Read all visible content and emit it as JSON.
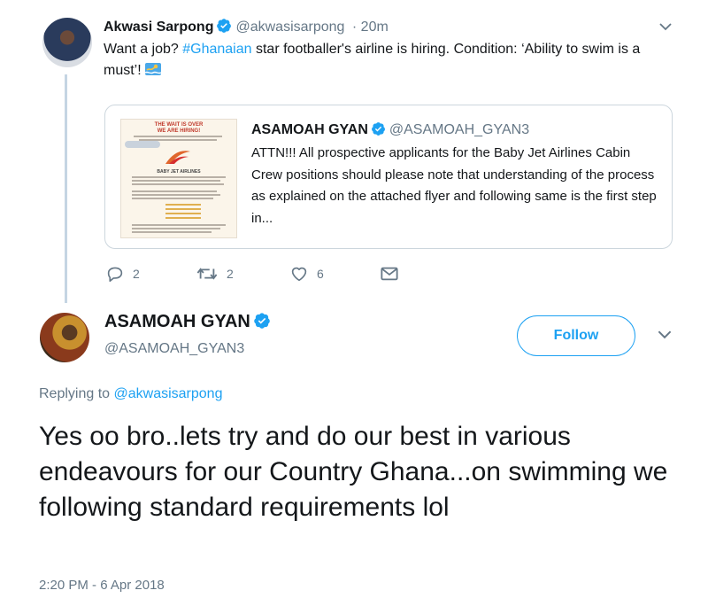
{
  "tweet1": {
    "author_name": "Akwasi Sarpong",
    "handle": "@akwasisarpong",
    "time": "· 20m",
    "text_before": "Want a job? ",
    "hashtag": "#Ghanaian",
    "text_after": " star footballer's airline is hiring. Condition: ‘Ability to swim is a must’! ",
    "emoji": "swimmer-emoji",
    "quoted": {
      "author_name": "ASAMOAH GYAN",
      "handle": "@ASAMOAH_GYAN3",
      "text": "ATTN!!! All prospective applicants for the Baby Jet Airlines Cabin Crew positions should please note that understanding of the process as explained on the attached flyer and following same is the first step in...",
      "flyer": {
        "title": "THE WAIT IS OVER\nWE ARE HIRING!",
        "brand": "BABY JET AIRLINES"
      }
    },
    "actions": {
      "reply_count": "2",
      "retweet_count": "2",
      "like_count": "6"
    }
  },
  "tweet2": {
    "author_name": "ASAMOAH GYAN",
    "handle": "@ASAMOAH_GYAN3",
    "follow_label": "Follow",
    "replying_prefix": "Replying to ",
    "replying_handle": "@akwasisarpong",
    "text": "Yes oo bro..lets try and do our best in various endeavours for our Country Ghana...on swimming we following standard requirements lol",
    "timestamp": "2:20 PM - 6 Apr 2018"
  },
  "colors": {
    "accent": "#1da1f2",
    "muted": "#657786",
    "border": "#ccd6dd"
  }
}
